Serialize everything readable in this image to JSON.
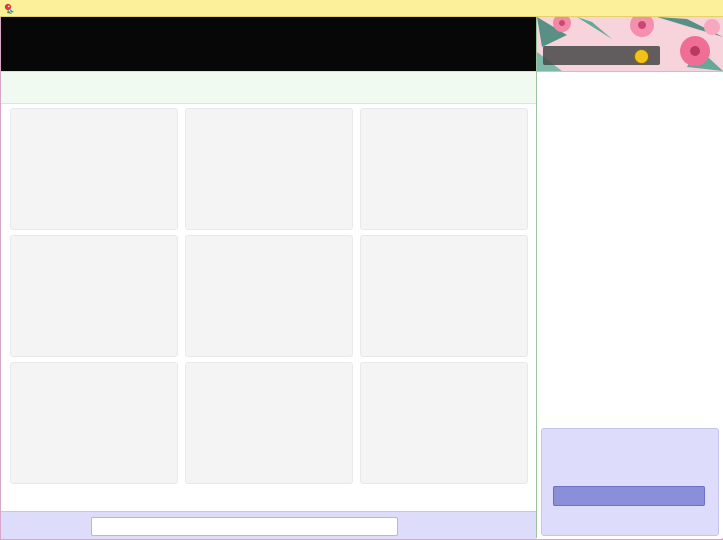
{
  "window": {
    "icon": "parrot-app-icon"
  },
  "banner": {
    "badge_icon": "coin-badge-icon",
    "badge_text": ""
  },
  "grid": {
    "tiles": [
      "",
      "",
      "",
      "",
      "",
      "",
      "",
      "",
      ""
    ]
  },
  "bottom": {
    "input_value": "",
    "input_placeholder": ""
  },
  "sidebar": {
    "button_label": ""
  },
  "colors": {
    "titlebar": "#fdf09a",
    "hero": "#070707",
    "strip": "#f1faf0",
    "tile": "#f4f4f4",
    "panel": "#dedcfb",
    "button": "#8b8fd9",
    "coin": "#f3c21a"
  }
}
